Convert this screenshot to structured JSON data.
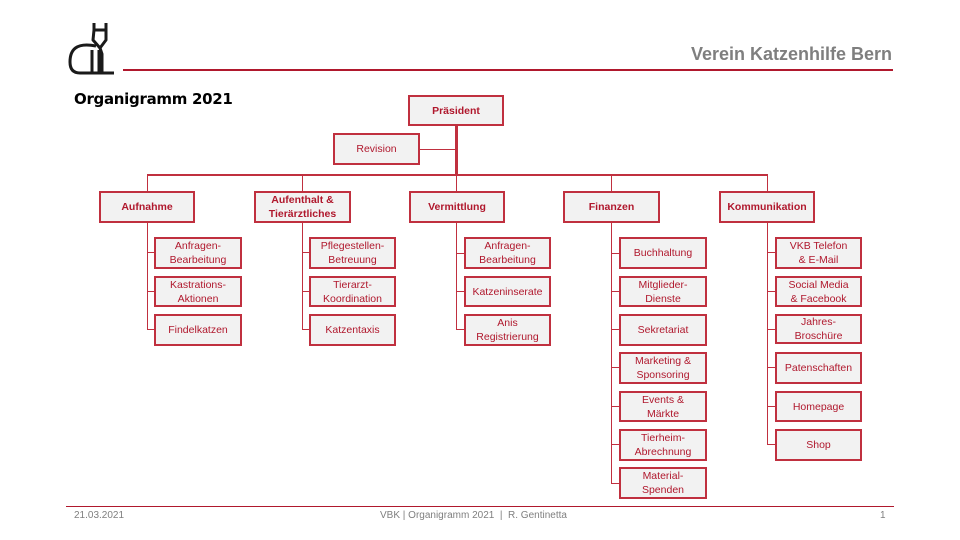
{
  "header": {
    "logo_icon": "cat-icon",
    "brand": "Verein Katzenhilfe Bern",
    "title": "Organigramm 2021"
  },
  "colors": {
    "accent": "#b0182d",
    "box_fill": "#f2f2f2",
    "brand_text": "#7f7f7f"
  },
  "org": {
    "president": "Präsident",
    "revision": "Revision",
    "departments": [
      {
        "label": "Aufnahme",
        "children": [
          "Anfragen-\nBearbeitung",
          "Kastrations-\nAktionen",
          "Findelkatzen"
        ]
      },
      {
        "label": "Aufenthalt &\nTierärztliches",
        "children": [
          "Pflegestellen-\nBetreuung",
          "Tierarzt-\nKoordination",
          "Katzentaxis"
        ]
      },
      {
        "label": "Vermittlung",
        "children": [
          "Anfragen-\nBearbeitung",
          "Katzeninserate",
          "Anis\nRegistrierung"
        ]
      },
      {
        "label": "Finanzen",
        "children": [
          "Buchhaltung",
          "Mitglieder-\nDienste",
          "Sekretariat",
          "Marketing &\nSponsoring",
          "Events &\nMärkte",
          "Tierheim-\nAbrechnung",
          "Material-\nSpenden"
        ]
      },
      {
        "label": "Kommunikation",
        "children": [
          "VKB Telefon\n& E-Mail",
          "Social Media\n& Facebook",
          "Jahres-\nBroschüre",
          "Patenschaften",
          "Homepage",
          "Shop"
        ]
      }
    ]
  },
  "footer": {
    "date": "21.03.2021",
    "center": "VBK | Organigramm 2021  |  R. Gentinetta",
    "page": "1"
  }
}
